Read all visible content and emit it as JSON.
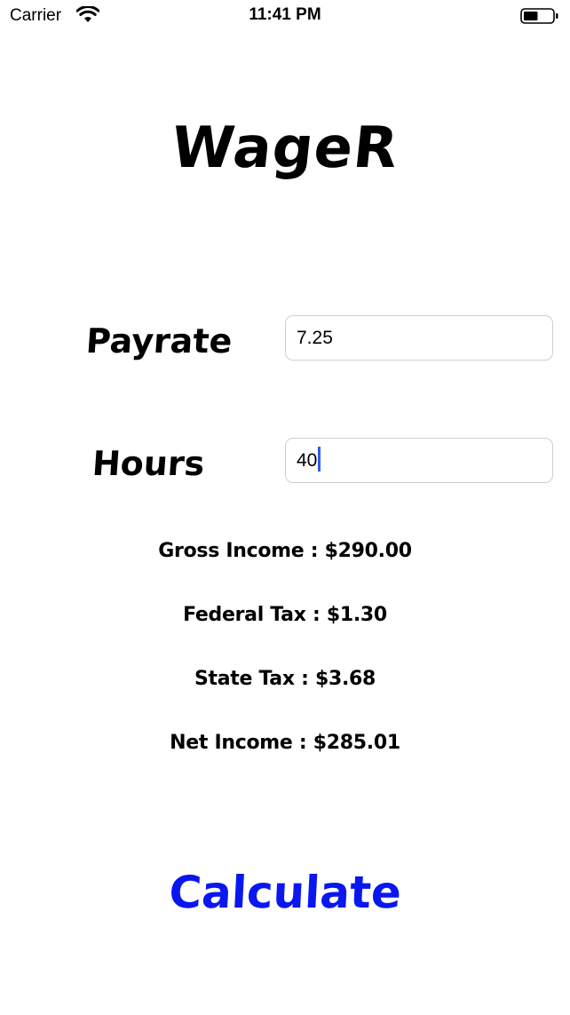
{
  "status_bar": {
    "carrier": "Carrier",
    "time": "11:41 PM",
    "battery_level": 0.5
  },
  "app": {
    "title": "WageR"
  },
  "form": {
    "payrate_label": "Payrate",
    "payrate_value": "7.25",
    "hours_label": "Hours",
    "hours_value": "40"
  },
  "results": {
    "gross_income": "Gross Income : $290.00",
    "federal_tax": "Federal Tax : $1.30",
    "state_tax": "State Tax : $3.68",
    "net_income": "Net Income : $285.01"
  },
  "actions": {
    "calculate_label": "Calculate"
  },
  "colors": {
    "accent": "#0a17f0",
    "caret": "#2f5bea"
  }
}
